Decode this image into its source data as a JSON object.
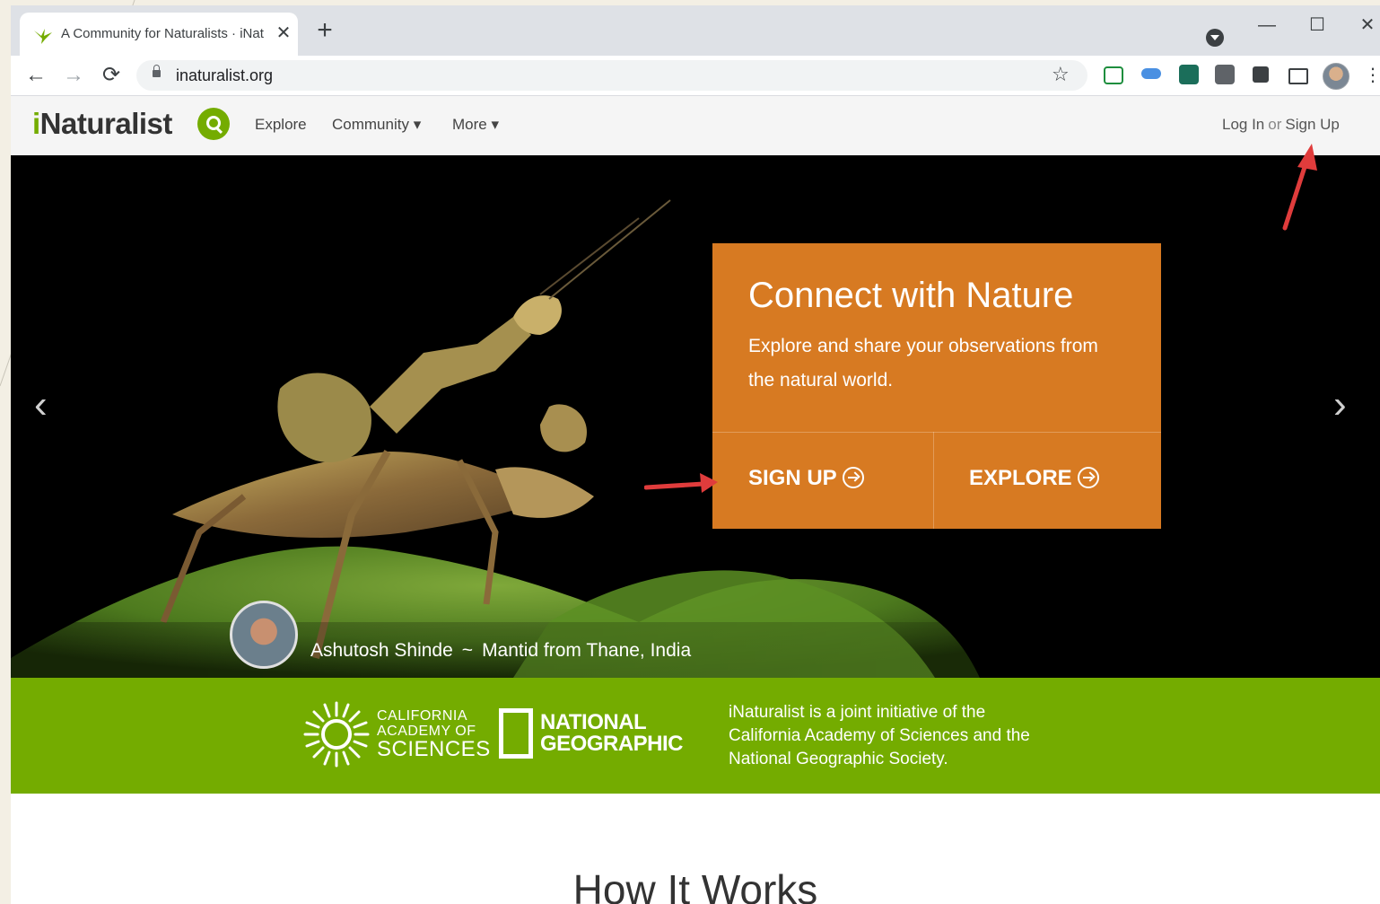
{
  "browser": {
    "tab_title": "A Community for Naturalists · iNaturalist",
    "tab_close": "✕",
    "new_tab": "+",
    "window_minimize": "—",
    "window_maximize": "☐",
    "window_close": "✕",
    "url": "inaturalist.org",
    "nav_back": "←",
    "nav_forward": "→",
    "nav_reload": "⟳",
    "bookmark_star": "☆",
    "menu": "⋮",
    "extensions": [
      "screen-extension-icon",
      "cloud-extension-icon",
      "script-extension-icon",
      "note-extension-icon",
      "puzzle-extensions-icon",
      "cast-icon"
    ]
  },
  "site": {
    "logo_prefix": "i",
    "logo_rest": "Naturalist",
    "nav": {
      "explore": "Explore",
      "community": "Community",
      "more": "More",
      "caret": "▾"
    },
    "login": "Log In",
    "or": "or",
    "signup": "Sign Up"
  },
  "hero": {
    "title": "Connect with Nature",
    "description": "Explore and share your observations from the natural world.",
    "signup_label": "SIGN UP",
    "explore_label": "EXPLORE",
    "prev": "‹",
    "next": "›",
    "photographer": "Ashutosh Shinde",
    "separator": "~",
    "photo_caption": "Mantid from Thane, India"
  },
  "partners": {
    "cas_line1": "CALIFORNIA",
    "cas_line2": "ACADEMY OF",
    "cas_line3": "SCIENCES",
    "ng_line1": "NATIONAL",
    "ng_line2": "GEOGRAPHIC",
    "description": "iNaturalist is a joint initiative of the California Academy of Sciences and the National Geographic Society."
  },
  "how_it_works": {
    "title": "How It Works"
  },
  "colors": {
    "brand_green": "#74ac00",
    "cta_orange": "#d77a22",
    "annotation_red": "#e03c3c"
  }
}
